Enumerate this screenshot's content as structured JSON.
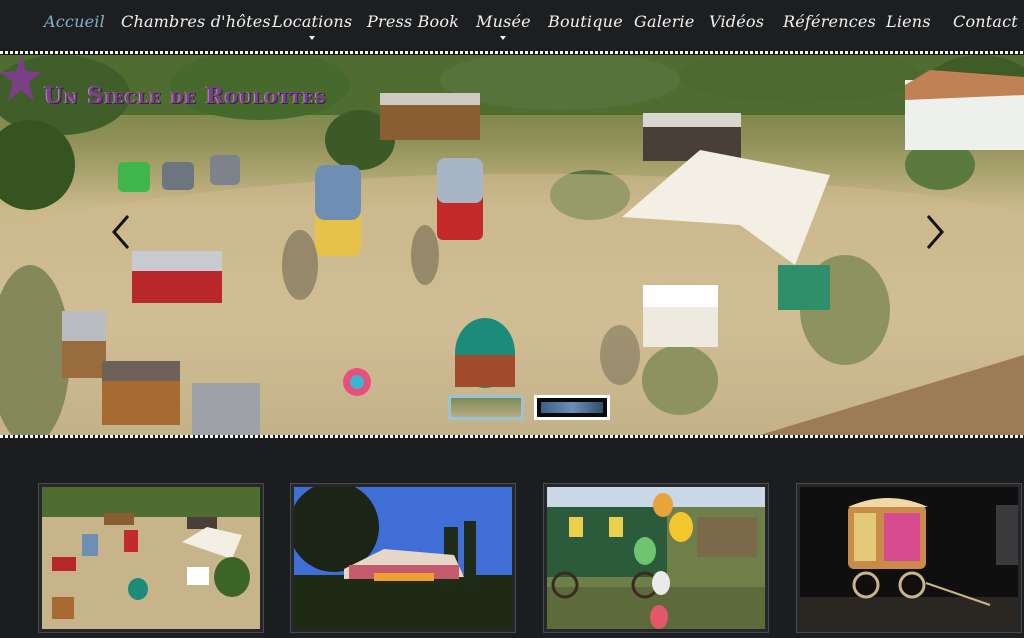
{
  "nav": {
    "items": [
      {
        "label": "Accueil",
        "active": true,
        "dropdown": false
      },
      {
        "label": "Chambres d'hôtes",
        "active": false,
        "dropdown": false
      },
      {
        "label": "Locations",
        "active": false,
        "dropdown": true
      },
      {
        "label": "Press Book",
        "active": false,
        "dropdown": false
      },
      {
        "label": "Musée",
        "active": false,
        "dropdown": true
      },
      {
        "label": "Boutique",
        "active": false,
        "dropdown": false
      },
      {
        "label": "Galerie",
        "active": false,
        "dropdown": false
      },
      {
        "label": "Vidéos",
        "active": false,
        "dropdown": false
      },
      {
        "label": "Références",
        "active": false,
        "dropdown": false
      },
      {
        "label": "Liens",
        "active": false,
        "dropdown": false
      },
      {
        "label": "Contact & P",
        "active": false,
        "dropdown": false
      }
    ],
    "active_color": "#7fb2c8",
    "text_color": "#f2f2f2"
  },
  "hero": {
    "logo_text": "Un Siecle de Roulottes",
    "logo_color": "#7a3f86",
    "prev_icon": "chevron-left-icon",
    "next_icon": "chevron-right-icon",
    "slides_count": 2,
    "active_slide": 1
  },
  "gallery": {
    "thumbnails": [
      {
        "scene": "aerial-caravan-field"
      },
      {
        "scene": "evening-party-tents"
      },
      {
        "scene": "green-caravan-lightbulbs"
      },
      {
        "scene": "caravan-on-stage"
      }
    ]
  },
  "colors": {
    "background": "#1c1d1f",
    "stitch": "#ffffff"
  }
}
